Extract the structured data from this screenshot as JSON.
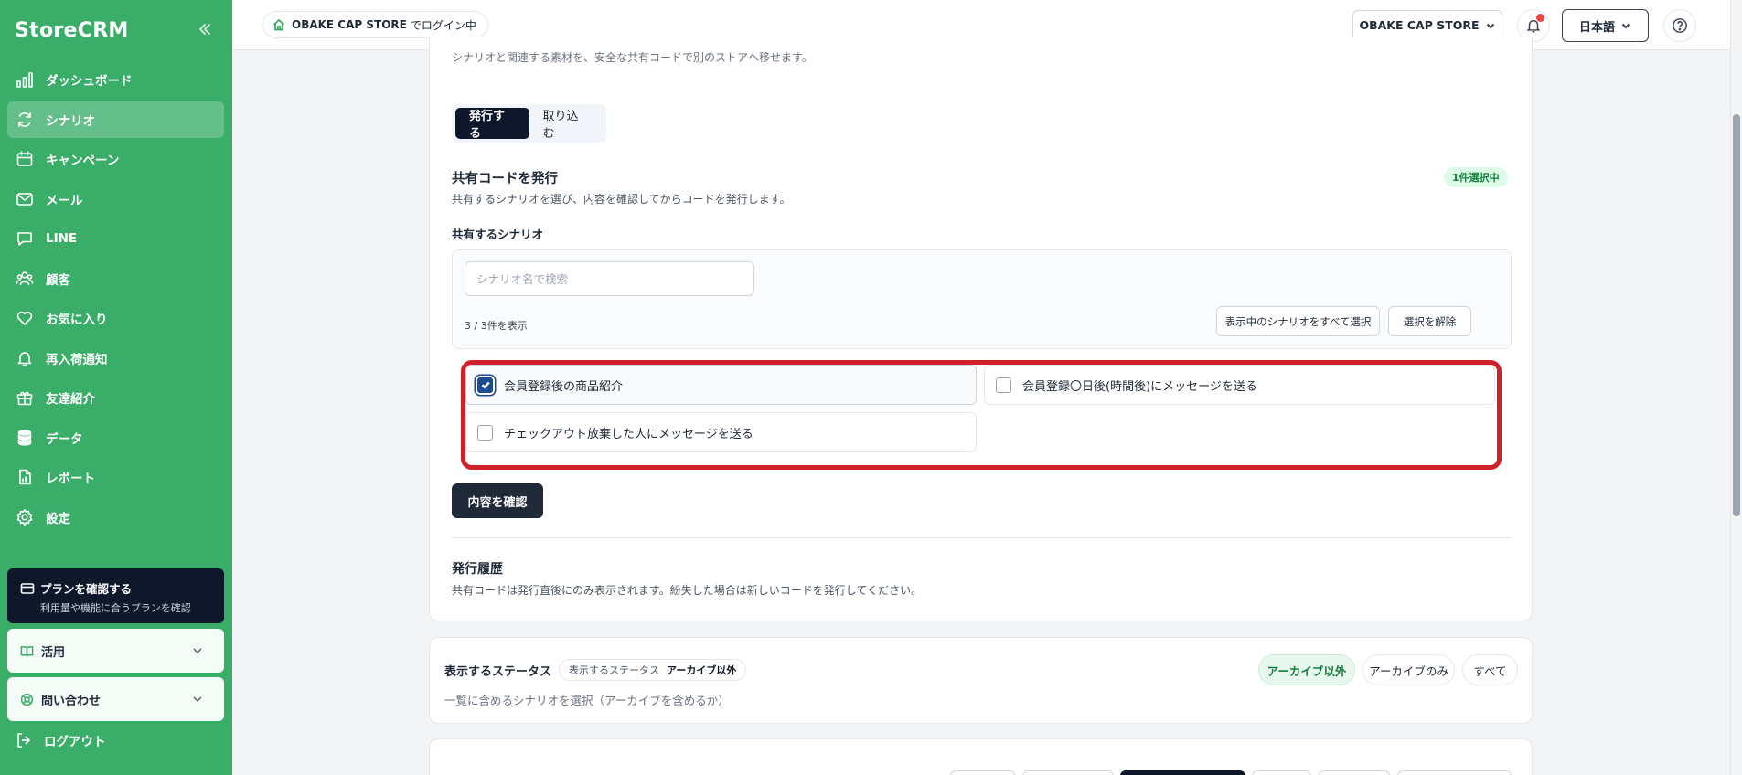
{
  "app": {
    "name": "StoreCRM"
  },
  "sidebar": {
    "items": [
      {
        "label": "ダッシュボード",
        "icon": "bar-chart-icon"
      },
      {
        "label": "シナリオ",
        "icon": "refresh-icon",
        "active": true
      },
      {
        "label": "キャンペーン",
        "icon": "calendar-icon"
      },
      {
        "label": "メール",
        "icon": "mail-icon"
      },
      {
        "label": "LINE",
        "icon": "chat-icon"
      },
      {
        "label": "顧客",
        "icon": "users-icon"
      },
      {
        "label": "お気に入り",
        "icon": "heart-icon"
      },
      {
        "label": "再入荷通知",
        "icon": "bell-icon"
      },
      {
        "label": "友達紹介",
        "icon": "gift-icon"
      },
      {
        "label": "データ",
        "icon": "database-icon"
      },
      {
        "label": "レポート",
        "icon": "file-icon"
      },
      {
        "label": "設定",
        "icon": "gear-icon"
      }
    ],
    "plan": {
      "title": "プランを確認する",
      "subtitle": "利用量や機能に合うプランを確認"
    },
    "accordions": [
      {
        "label": "活用"
      },
      {
        "label": "問い合わせ"
      }
    ],
    "logout": "ログアウト"
  },
  "header": {
    "store_pill": {
      "store": "OBAKE CAP STORE",
      "suffix": "でログイン中"
    },
    "store_select": "OBAKE CAP STORE",
    "language": "日本語"
  },
  "share": {
    "description": "シナリオと関連する素材を、安全な共有コードで別のストアへ移せます。",
    "tabs": [
      {
        "label": "発行する",
        "active": true
      },
      {
        "label": "取り込む"
      }
    ],
    "title": "共有コードを発行",
    "subtitle": "共有するシナリオを選び、内容を確認してからコードを発行します。",
    "badge": "1件選択中",
    "scenario_label": "共有するシナリオ",
    "search_placeholder": "シナリオ名で検索",
    "count": "3 / 3件を表示",
    "select_all": "表示中のシナリオをすべて選択",
    "clear": "選択を解除",
    "scenarios": [
      {
        "label": "会員登録後の商品紹介",
        "checked": true
      },
      {
        "label": "会員登録〇日後(時間後)にメッセージを送る",
        "checked": false
      },
      {
        "label": "チェックアウト放棄した人にメッセージを送る",
        "checked": false
      }
    ],
    "confirm": "内容を確認",
    "history_title": "発行履歴",
    "history_sub": "共有コードは発行直後にのみ表示されます。紛失した場合は新しいコードを発行してください。"
  },
  "status_filter": {
    "label": "表示するステータス",
    "chip_label": "表示するステータス",
    "chip_value": "アーカイブ以外",
    "sub": "一覧に含めるシナリオを選択（アーカイブを含めるか）",
    "options": [
      {
        "label": "アーカイブ以外",
        "active": true
      },
      {
        "label": "アーカイブのみ"
      },
      {
        "label": "すべて"
      }
    ]
  },
  "colors": {
    "brand": "#3aae69",
    "dark": "#0f172a",
    "highlight": "#d0202a"
  }
}
